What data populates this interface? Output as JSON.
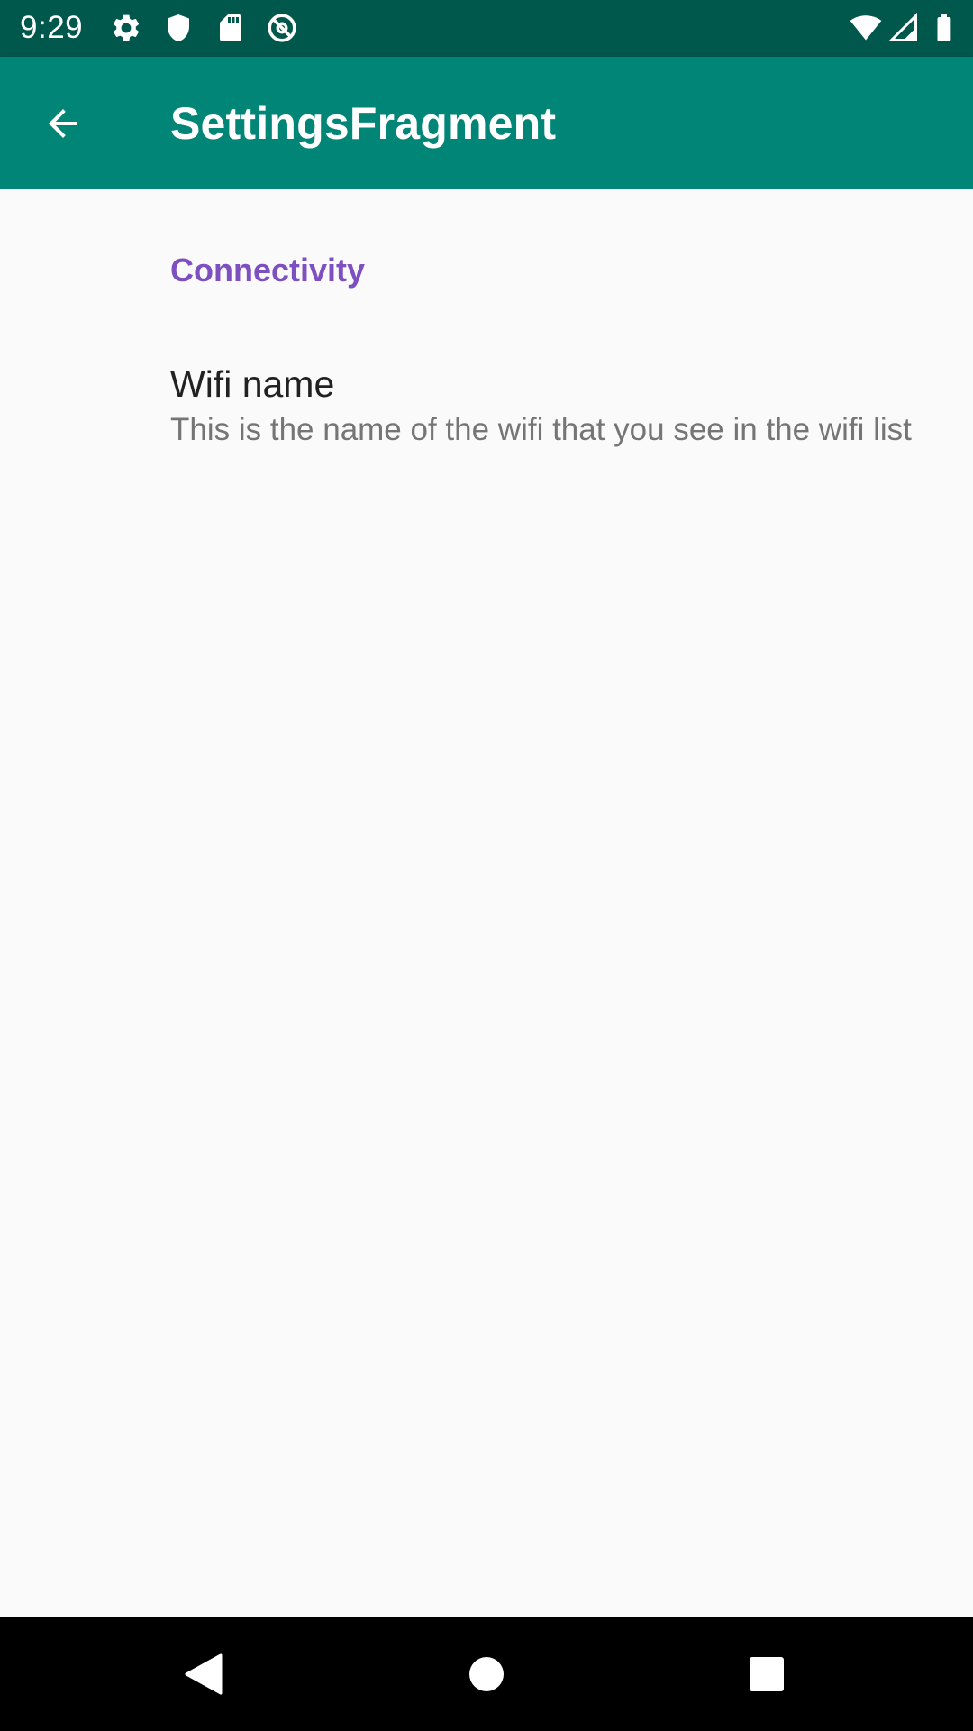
{
  "status_bar": {
    "time": "9:29",
    "left_icons": [
      "gear-icon",
      "shield-icon",
      "sd-card-icon",
      "blocked-at-icon"
    ],
    "right_icons": [
      "wifi-icon",
      "cell-signal-icon",
      "battery-icon"
    ],
    "background": "#00574b"
  },
  "app_bar": {
    "title": "SettingsFragment",
    "back_icon": "arrow-back-icon",
    "background": "#008577"
  },
  "preferences": {
    "category_title": "Connectivity",
    "category_color": "#7e4fc0",
    "items": [
      {
        "title": "Wifi name",
        "summary": "This is the name of the wifi that you see in the wifi list"
      }
    ]
  },
  "nav_bar": {
    "buttons": [
      "back-triangle-icon",
      "home-circle-icon",
      "recents-square-icon"
    ]
  }
}
